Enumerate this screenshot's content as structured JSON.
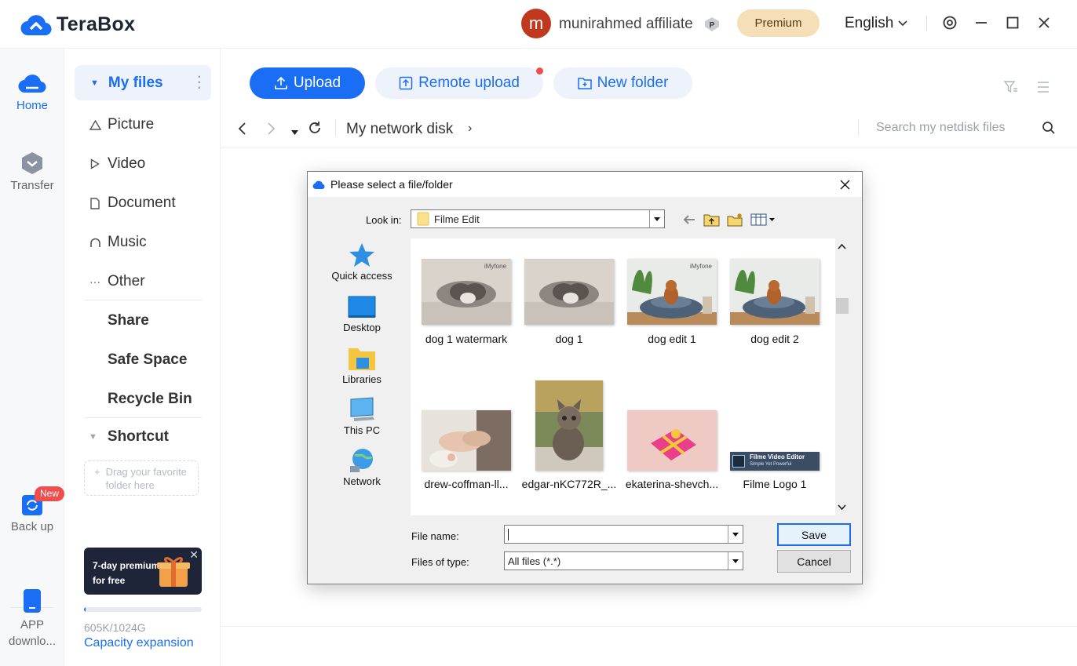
{
  "app": {
    "name": "TeraBox",
    "user": {
      "initial": "m",
      "name": "munirahmed affiliate"
    },
    "premium_label": "Premium",
    "language": "English"
  },
  "rail": {
    "home": "Home",
    "transfer": "Transfer",
    "backup": "Back up",
    "backup_badge": "New",
    "app_download_line1": "APP",
    "app_download_line2": "downlo..."
  },
  "sidebar": {
    "my_files": "My files",
    "items": [
      "Picture",
      "Video",
      "Document",
      "Music",
      "Other"
    ],
    "share": "Share",
    "safe_space": "Safe Space",
    "recycle_bin": "Recycle Bin",
    "shortcut": "Shortcut",
    "shortcut_hint_line1": "Drag your favorite",
    "shortcut_hint_line2": "folder here",
    "promo_line1": "7-day premium",
    "promo_line2": "for free",
    "capacity": "605K/1024G",
    "capacity_used_fraction": 0.0006,
    "capacity_expansion": "Capacity expansion"
  },
  "toolbar": {
    "upload": "Upload",
    "remote_upload": "Remote upload",
    "new_folder": "New folder"
  },
  "breadcrumb": {
    "current": "My network disk",
    "search_placeholder": "Search my netdisk files"
  },
  "dialog": {
    "title": "Please select a file/folder",
    "look_in_label": "Look in:",
    "look_in_value": "Filme Edit",
    "places": [
      "Quick access",
      "Desktop",
      "Libraries",
      "This PC",
      "Network"
    ],
    "files": [
      {
        "name": "dog 1 watermark",
        "watermark": "iMyfone"
      },
      {
        "name": "dog 1",
        "watermark": ""
      },
      {
        "name": "dog edit 1",
        "watermark": "iMyfone"
      },
      {
        "name": "dog edit 2",
        "watermark": ""
      },
      {
        "name": "drew-coffman-ll...",
        "watermark": ""
      },
      {
        "name": "edgar-nKC772R_...",
        "watermark": ""
      },
      {
        "name": "ekaterina-shevch...",
        "watermark": ""
      },
      {
        "name": "Filme Logo 1",
        "watermark": "",
        "logo_line1": "Filme Video Editor",
        "logo_line2": "Simple Yet Powerful"
      }
    ],
    "file_name_label": "File name:",
    "file_name_value": "",
    "file_type_label": "Files of type:",
    "file_type_value": "All files (*.*)",
    "save": "Save",
    "cancel": "Cancel"
  },
  "colors": {
    "accent": "#1a6ef5",
    "premium_bg": "#f5dfb6",
    "badge_red": "#f04d4d",
    "avatar": "#c0391f"
  }
}
